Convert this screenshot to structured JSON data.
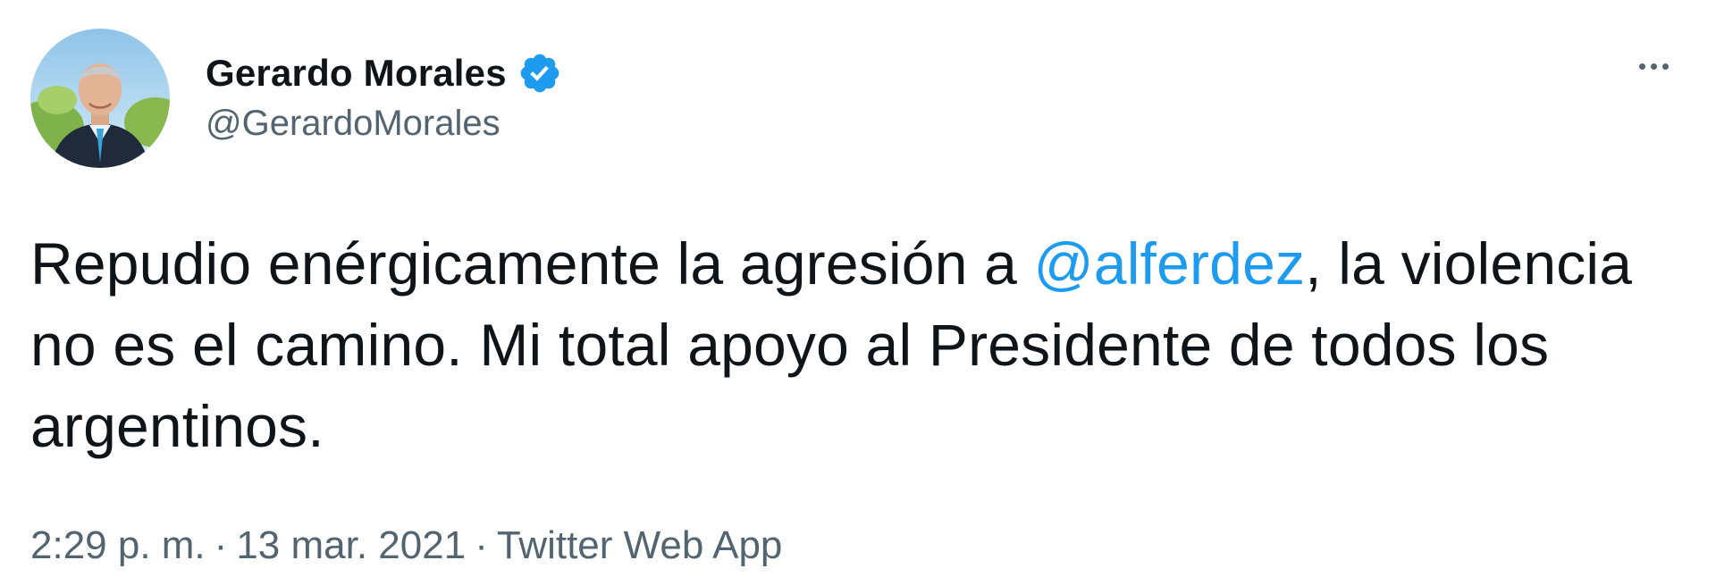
{
  "author": {
    "display_name": "Gerardo Morales",
    "handle": "@GerardoMorales",
    "verified": true
  },
  "icons": {
    "verified": "verified-badge-icon",
    "more": "more-options-icon"
  },
  "tweet": {
    "text_before": "Repudio enérgicamente la agresión a ",
    "mention": "@alferdez",
    "text_after": ", la violencia no es el camino. Mi total apoyo al Presidente de todos los argentinos."
  },
  "meta": {
    "time": "2:29 p. m.",
    "separator": "·",
    "date": "13 mar. 2021",
    "source": "Twitter Web App"
  },
  "colors": {
    "accent": "#1d9bf0",
    "secondary_text": "#536471",
    "primary_text": "#0f1419"
  }
}
